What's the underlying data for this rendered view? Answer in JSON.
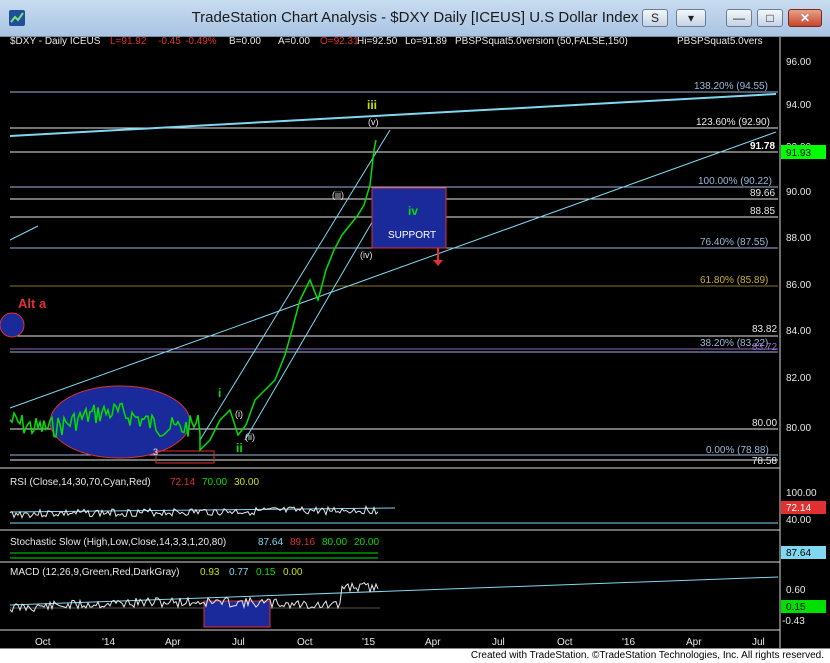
{
  "window": {
    "title": "TradeStation Chart Analysis - $DXY Daily [ICEUS] U.S Dollar Index",
    "buttons": {
      "s": "S",
      "chart": "▾",
      "minimize": "—",
      "maximize": "□",
      "close": "✕"
    }
  },
  "header": {
    "symbol": "$DXY - Daily  ICEUS",
    "last": "L=91.92",
    "change": "-0.45",
    "pct": "-0.49%",
    "bid": "B=0.00",
    "ask": "A=0.00",
    "open": "O=92.31",
    "high": "Hi=92.50",
    "low": "Lo=91.89",
    "study1": "PBSPSquat5.0version (50,FALSE,150)",
    "study2": "PBSPSquat5.0vers"
  },
  "price_axis": [
    "96.00",
    "94.00",
    "92.00",
    "90.00",
    "88.00",
    "86.00",
    "84.00",
    "82.00",
    "80.00"
  ],
  "price_badge": "91.93",
  "fib_labels": [
    "138.20% (94.55)",
    "123.60% (92.90)",
    "100.00% (90.22)",
    "76.40% (87.55)",
    "61.80% (85.89)",
    "38.20% (83.22)",
    "0.00% (78.88)"
  ],
  "level_labels": [
    "91.78",
    "89.66",
    "88.85",
    "83.82",
    "83.72",
    "80.00",
    "78.58"
  ],
  "wave_labels": {
    "iii": "iii",
    "v": "(v)",
    "iii_small": "(iii)",
    "iv": "iv",
    "iv_small": "(iv)",
    "i": "i",
    "i_small": "(i)",
    "ii": "ii",
    "ii_small": "(ii)",
    "three": "3",
    "alt": "Alt a",
    "support": "SUPPORT"
  },
  "rsi": {
    "label": "RSI (Close,14,30,70,Cyan,Red)",
    "v1": "72.14",
    "v2": "70.00",
    "v3": "30.00",
    "axis": [
      "100.00",
      "40.00"
    ],
    "badge": "72.14"
  },
  "stoch": {
    "label": "Stochastic Slow (High,Low,Close,14,3,3,1,20,80)",
    "v1": "87.64",
    "v2": "89.16",
    "v3": "80.00",
    "v4": "20.00",
    "badge": "87.64"
  },
  "macd": {
    "label": "MACD (12,26,9,Green,Red,DarkGray)",
    "v1": "0.93",
    "v2": "0.77",
    "v3": "0.15",
    "v4": "0.00",
    "axis": [
      "0.60",
      "-0.43"
    ],
    "badge": "0.15"
  },
  "time_axis": [
    "Oct",
    "'14",
    "Apr",
    "Jul",
    "Oct",
    "'15",
    "Apr",
    "Jul",
    "Oct",
    "'16",
    "Apr",
    "Jul"
  ],
  "footer": "Created with TradeStation. ©TradeStation Technologies, Inc. All rights reserved.",
  "colors": {
    "price": "#00e000",
    "cyan": "#7fd8f0",
    "fib": "#9ab8d8",
    "support": "#1a2a9a",
    "red": "#e03030"
  }
}
